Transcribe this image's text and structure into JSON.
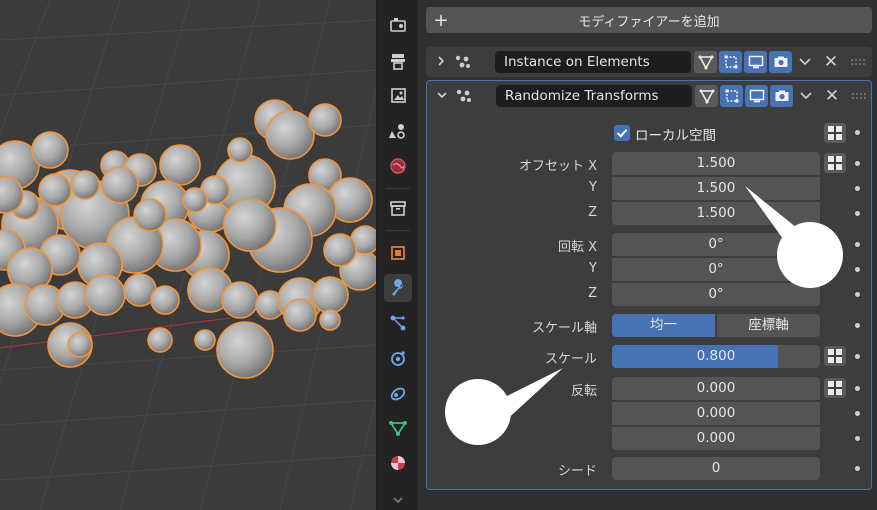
{
  "viewport": {
    "description_icon": "3d-viewport"
  },
  "tabs": [
    {
      "icon": "tool-icon"
    },
    {
      "icon": "render-icon"
    },
    {
      "icon": "output-icon"
    },
    {
      "icon": "view-layer-icon"
    },
    {
      "icon": "scene-icon"
    },
    {
      "icon": "world-icon"
    },
    {
      "icon": "collection-icon"
    },
    {
      "icon": "object-icon"
    },
    {
      "icon": "modifier-wrench-icon"
    },
    {
      "icon": "particles-icon"
    },
    {
      "icon": "physics-icon"
    },
    {
      "icon": "constraints-icon"
    },
    {
      "icon": "data-icon"
    },
    {
      "icon": "material-icon"
    }
  ],
  "panel": {
    "add_modifier_label": "モディファイアーを追加",
    "modifier1": {
      "name": "Instance on Elements"
    },
    "modifier2": {
      "name": "Randomize Transforms",
      "local_space_label": "ローカル空間",
      "local_space_checked": true,
      "offset_label": "オフセット X",
      "offset_y_label": "Y",
      "offset_z_label": "Z",
      "offset_x": "1.500",
      "offset_y": "1.500",
      "offset_z": "1.500",
      "rotation_label": "回転 X",
      "rotation_y_label": "Y",
      "rotation_z_label": "Z",
      "rotation_x": "0°",
      "rotation_y": "0°",
      "rotation_z": "0°",
      "scale_axis_label": "スケール軸",
      "scale_axis_options": [
        "均一",
        "座標軸"
      ],
      "scale_axis_selected": "均一",
      "scale_label": "スケール",
      "scale_value": "0.800",
      "scale_fraction": 0.8,
      "flip_label": "反転",
      "flip_x": "0.000",
      "flip_y": "0.000",
      "flip_z": "0.000",
      "seed_label": "シード",
      "seed_value": "0"
    }
  },
  "colors": {
    "accent": "#4772b3",
    "selection_outline": "#f5953a",
    "panel_bg": "#303030",
    "field_bg": "#545454"
  }
}
